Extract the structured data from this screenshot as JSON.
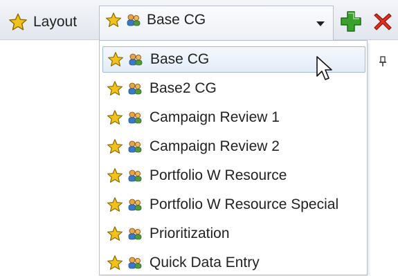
{
  "toolbar": {
    "layout_label": "Layout",
    "selected_view": "Base CG",
    "icons": [
      "star-icon",
      "people-icon",
      "chevron-down-icon",
      "add-icon",
      "delete-icon"
    ]
  },
  "dropdown": {
    "items": [
      {
        "label": "Base CG",
        "selected": true
      },
      {
        "label": "Base2 CG"
      },
      {
        "label": "Campaign Review 1"
      },
      {
        "label": "Campaign Review 2"
      },
      {
        "label": "Portfolio W Resource"
      },
      {
        "label": "Portfolio W Resource Special"
      },
      {
        "label": "Prioritization"
      },
      {
        "label": "Quick Data Entry"
      }
    ]
  },
  "colors": {
    "star": "#f2c21b",
    "add": "#3aa12c",
    "delete": "#e0301e",
    "selection_border": "#9fb8dc"
  }
}
